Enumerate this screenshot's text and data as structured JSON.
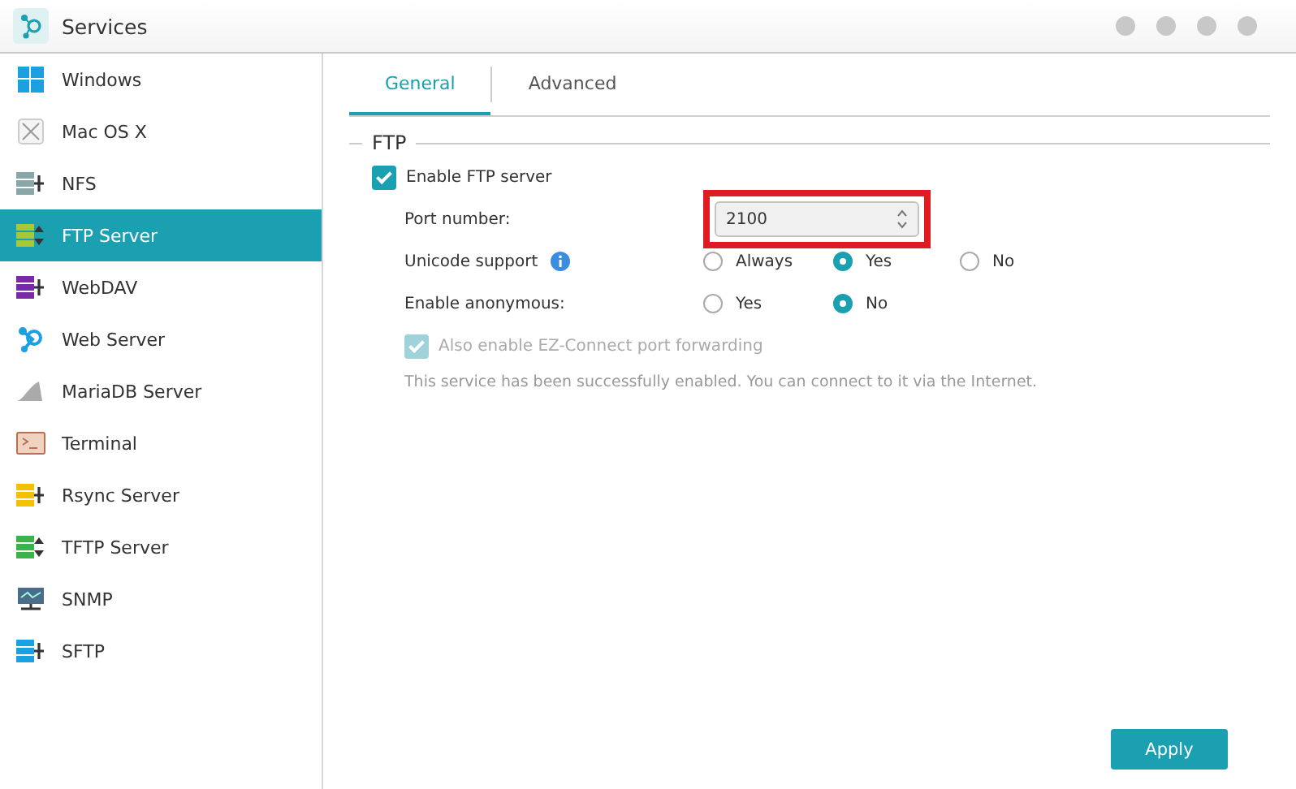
{
  "window": {
    "title": "Services"
  },
  "sidebar": {
    "items": [
      {
        "label": "Windows",
        "selected": false
      },
      {
        "label": "Mac OS X",
        "selected": false
      },
      {
        "label": "NFS",
        "selected": false
      },
      {
        "label": "FTP Server",
        "selected": true
      },
      {
        "label": "WebDAV",
        "selected": false
      },
      {
        "label": "Web Server",
        "selected": false
      },
      {
        "label": "MariaDB Server",
        "selected": false
      },
      {
        "label": "Terminal",
        "selected": false
      },
      {
        "label": "Rsync Server",
        "selected": false
      },
      {
        "label": "TFTP Server",
        "selected": false
      },
      {
        "label": "SNMP",
        "selected": false
      },
      {
        "label": "SFTP",
        "selected": false
      }
    ]
  },
  "tabs": [
    {
      "label": "General",
      "selected": true
    },
    {
      "label": "Advanced",
      "selected": false
    }
  ],
  "section": {
    "title": "FTP",
    "enable": {
      "label": "Enable FTP server",
      "checked": true,
      "disabled": false
    },
    "port": {
      "label": "Port number:",
      "value": "2100",
      "highlighted": true
    },
    "unicode": {
      "label": "Unicode support",
      "options": [
        {
          "label": "Always",
          "selected": false
        },
        {
          "label": "Yes",
          "selected": true
        },
        {
          "label": "No",
          "selected": false
        }
      ]
    },
    "anonymous": {
      "label": "Enable anonymous:",
      "options": [
        {
          "label": "Yes",
          "selected": false
        },
        {
          "label": "No",
          "selected": true
        }
      ]
    },
    "ez_connect": {
      "label": "Also enable EZ-Connect port forwarding",
      "checked": true,
      "disabled": true
    },
    "message": "This service has been successfully enabled. You can connect to it via the Internet."
  },
  "apply_button": "Apply"
}
